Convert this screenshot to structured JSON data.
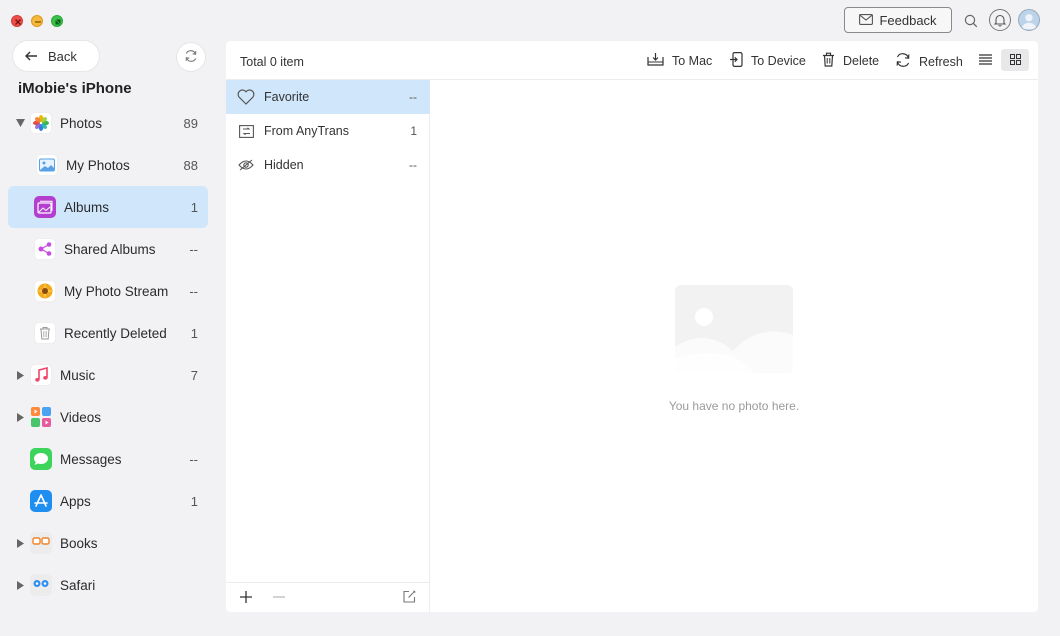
{
  "window": {
    "controls": [
      "close",
      "minimize",
      "maximize"
    ]
  },
  "topbar": {
    "feedback_label": "Feedback",
    "icons": [
      "mail-icon",
      "search-icon",
      "bell-icon",
      "avatar"
    ]
  },
  "sidebar": {
    "back_label": "Back",
    "device_name": "iMobie's iPhone",
    "items": [
      {
        "label": "Photos",
        "count": "89",
        "icon": "photos-icon",
        "expanded": true
      },
      {
        "label": "My Photos",
        "count": "88",
        "icon": "my-photos-icon"
      },
      {
        "label": "Albums",
        "count": "1",
        "icon": "albums-icon",
        "selected": true
      },
      {
        "label": "Shared Albums",
        "count": "--",
        "icon": "shared-albums-icon"
      },
      {
        "label": "My Photo Stream",
        "count": "--",
        "icon": "photo-stream-icon"
      },
      {
        "label": "Recently Deleted",
        "count": "1",
        "icon": "trash-icon"
      },
      {
        "label": "Music",
        "count": "7",
        "icon": "music-icon"
      },
      {
        "label": "Videos",
        "count": "",
        "icon": "videos-icon"
      },
      {
        "label": "Messages",
        "count": "--",
        "icon": "messages-icon"
      },
      {
        "label": "Apps",
        "count": "1",
        "icon": "apps-icon"
      },
      {
        "label": "Books",
        "count": "",
        "icon": "books-icon"
      },
      {
        "label": "Safari",
        "count": "",
        "icon": "safari-icon"
      }
    ]
  },
  "toolbar": {
    "total": "Total 0 item",
    "to_mac": "To Mac",
    "to_device": "To Device",
    "delete": "Delete",
    "refresh": "Refresh"
  },
  "albums": [
    {
      "label": "Favorite",
      "count": "--",
      "icon": "heart-icon",
      "selected": true
    },
    {
      "label": "From AnyTrans",
      "count": "1",
      "icon": "anytrans-album-icon"
    },
    {
      "label": "Hidden",
      "count": "--",
      "icon": "hidden-eye-icon"
    }
  ],
  "content": {
    "empty_message": "You have no photo here."
  },
  "colors": {
    "selected_bg": "#cfe6fb",
    "background": "#f2f2f4"
  }
}
